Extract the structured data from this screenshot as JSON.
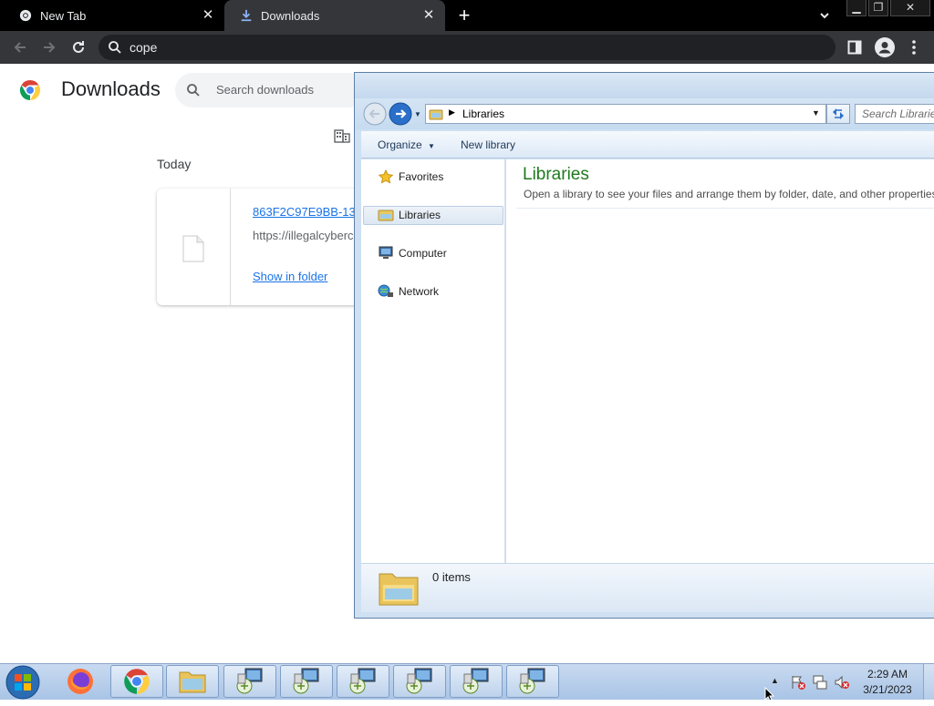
{
  "browser": {
    "tabs": [
      {
        "title": "New Tab",
        "icon": "chrome-icon"
      },
      {
        "title": "Downloads",
        "icon": "download-icon"
      }
    ],
    "omnibox": {
      "value": "cope"
    },
    "icons": {
      "back": "back-arrow-icon",
      "forward": "forward-arrow-icon",
      "reload": "reload-icon",
      "search": "search-icon",
      "side_panel": "side-panel-icon",
      "profile": "profile-icon",
      "menu": "kebab-menu-icon",
      "new_tab": "plus-icon",
      "tab_search": "chevron-down-icon"
    }
  },
  "downloads": {
    "title": "Downloads",
    "search_placeholder": "Search downloads",
    "section": "Today",
    "items": [
      {
        "filename": "863F2C97E9BB-13",
        "url": "https://illegalcyberc",
        "action": "Show in folder"
      }
    ]
  },
  "explorer": {
    "address": "Libraries",
    "search_placeholder": "Search Librarie",
    "toolbar": {
      "organize": "Organize",
      "new_library": "New library"
    },
    "nav": [
      {
        "label": "Favorites",
        "icon": "star-icon"
      },
      {
        "label": "Libraries",
        "icon": "libraries-icon",
        "selected": true
      },
      {
        "label": "Computer",
        "icon": "computer-icon"
      },
      {
        "label": "Network",
        "icon": "network-icon"
      }
    ],
    "heading": "Libraries",
    "description": "Open a library to see your files and arrange them by folder, date, and other properties.",
    "status": "0 items"
  },
  "taskbar": {
    "pinned": [
      "windows-start-icon",
      "firefox-icon",
      "chrome-icon",
      "explorer-folder-icon",
      "network-setup-icon",
      "network-setup-icon",
      "network-setup-icon",
      "network-setup-icon",
      "network-setup-icon",
      "network-setup-icon"
    ],
    "clock": {
      "time": "2:29 AM",
      "date": "3/21/2023"
    }
  },
  "colors": {
    "accent": "#1a73e8",
    "library_heading": "#1e7a1e",
    "chrome_dark": "#35363a"
  }
}
